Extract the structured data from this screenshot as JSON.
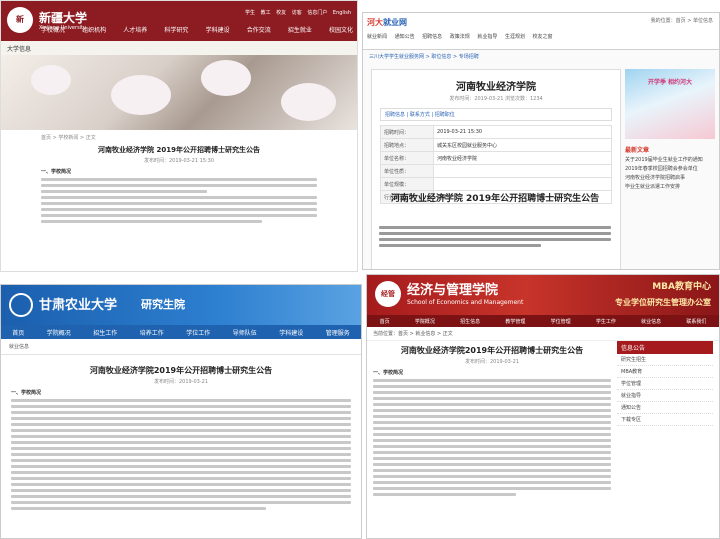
{
  "p1": {
    "logo_char": "新",
    "logo_text": "新疆大学",
    "logo_sub": "Xinjiang University",
    "toplinks": "学生 教工 校友 访客 信息门户 English",
    "nav": [
      "学校概况",
      "组织机构",
      "人才培养",
      "科学研究",
      "学科建设",
      "合作交流",
      "招生就业",
      "校园文化"
    ],
    "section": "大学信息",
    "crumb": "首页 > 学校新闻 > 正文",
    "title": "河南牧业经济学院 2019年公开招聘博士研究生公告",
    "meta": "发布时间：2019-03-21 15:30",
    "heading": "一、学校简况"
  },
  "p2": {
    "brand_a": "河大",
    "brand_b": "就业网",
    "toplink": "我的位置：首页 > 单位信息",
    "subnav": "就业新闻 通知公告 招聘信息 政策法规 就业指导 生涯规划 校友之窗",
    "crumbs": "三川大学学生就业服务网 > 职位信息 > 专场招聘",
    "job_title": "河南牧业经济学院",
    "job_meta": "发布时间：2019-03-21 浏览次数：1234",
    "tabs": "招聘信息 | 联系方式 | 招聘职位",
    "rows": [
      {
        "k": "招聘时间：",
        "v": "2019-03-21 15:30"
      },
      {
        "k": "招聘地点：",
        "v": "城关东区校园就业服务中心"
      },
      {
        "k": "单位名称：",
        "v": "河南牧业经济学院"
      },
      {
        "k": "单位性质：",
        "v": ""
      },
      {
        "k": "单位规模：",
        "v": ""
      },
      {
        "k": "行业类型：",
        "v": "高校"
      }
    ],
    "big_title": "河南牧业经济学院 2019年公开招聘博士研究生公告",
    "kid_band": "开学季 相约河大",
    "side_head": "最新文章",
    "side_items": [
      "关于2019届毕业生就业工作的通知",
      "2019年春季校园招聘会参会单位",
      "河南牧业经济学院招聘启事",
      "毕业生就业派遣工作安排"
    ]
  },
  "p3": {
    "name": "甘肃农业大学",
    "sub": "研究生院",
    "nav": [
      "首页",
      "学院概况",
      "招生工作",
      "培养工作",
      "学位工作",
      "导师队伍",
      "学科建设",
      "管理服务"
    ],
    "sec": "就业信息",
    "title": "河南牧业经济学院2019年公开招聘博士研究生公告",
    "meta": "发布时间：2019-03-21",
    "heading": "一、学校简况"
  },
  "p4": {
    "seal": "经管",
    "cn": "经济与管理学院",
    "en": "School of Economics and Management",
    "right": "MBA教育中心",
    "right2": "专业学位研究生管理办公室",
    "nav": [
      "首页",
      "学院概况",
      "招生信息",
      "教学管理",
      "学位管理",
      "学生工作",
      "就业信息",
      "联系我们"
    ],
    "crumbs": "当前位置：首页 > 就业信息 > 正文",
    "title": "河南牧业经济学院2019年公开招聘博士研究生公告",
    "meta": "发布时间：2019-03-21",
    "heading": "一、学校简况",
    "side_head": "信息公告",
    "side_items": [
      "研究生招生",
      "MBA教育",
      "学位管理",
      "就业指导",
      "通知公告",
      "下载专区"
    ]
  }
}
